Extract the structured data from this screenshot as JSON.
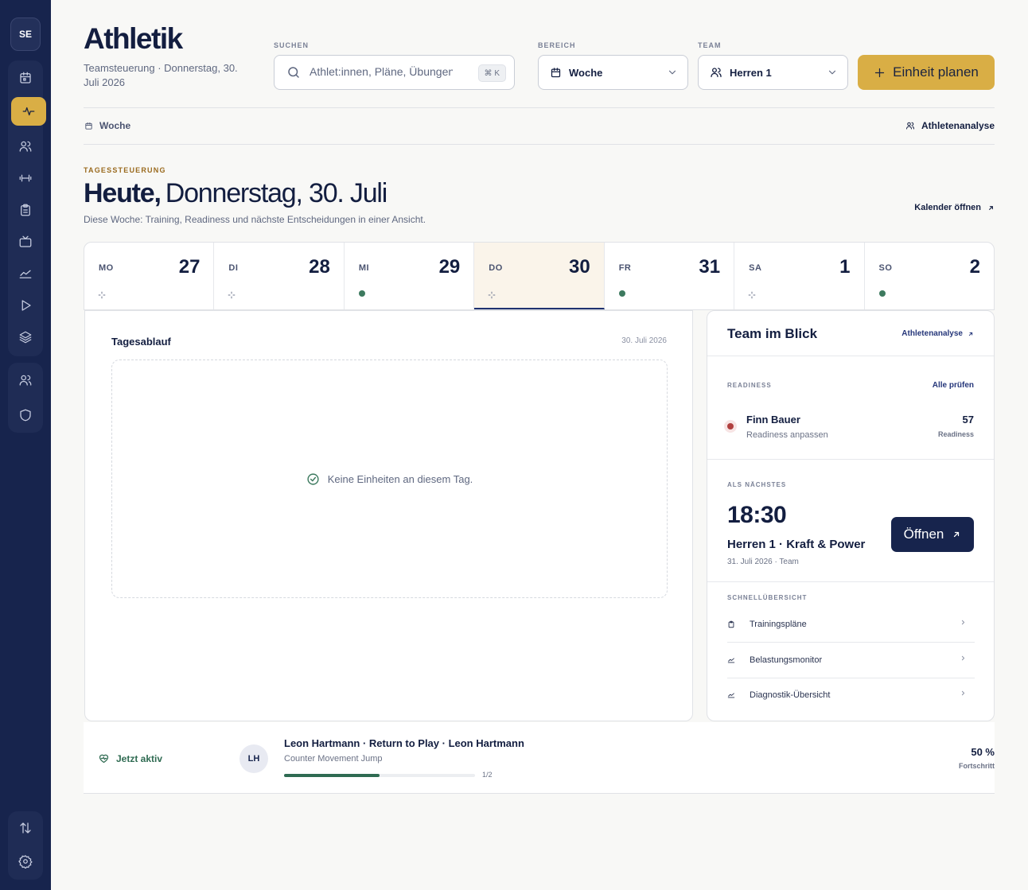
{
  "sidebar": {
    "avatar": "SE",
    "items": [
      {
        "icon": "calendar-icon"
      },
      {
        "icon": "activity-icon",
        "active": true
      },
      {
        "icon": "users-icon"
      },
      {
        "icon": "dumbbell-icon"
      },
      {
        "icon": "clipboard-icon"
      },
      {
        "icon": "tv-icon"
      },
      {
        "icon": "chart-line-icon"
      },
      {
        "icon": "play-icon"
      },
      {
        "icon": "layers-icon"
      },
      {
        "icon": "team-icon"
      },
      {
        "icon": "shield-icon"
      },
      {
        "icon": "sort-arrows-icon"
      },
      {
        "icon": "gear-icon"
      }
    ]
  },
  "header": {
    "title": "Athletik",
    "subtitle": "Teamsteuerung · Donnerstag, 30. Juli 2026",
    "search": {
      "label": "SUCHEN",
      "placeholder": "Athlet:innen, Pläne, Übungen",
      "shortcut": "⌘ K"
    },
    "range": {
      "label": "BEREICH",
      "value": "Woche"
    },
    "team": {
      "label": "TEAM",
      "value": "Herren 1"
    },
    "plan_button": "Einheit planen",
    "tab_left": "Woche",
    "tab_right": "Athletenanalyse"
  },
  "day_section": {
    "eyebrow": "TAGESSTEUERUNG",
    "heading_bold": "Heute,",
    "heading_rest": "Donnerstag, 30. Juli",
    "description": "Diese Woche: Training, Readiness und nächste Entscheidungen in einer Ansicht.",
    "calendar_link": "Kalender öffnen"
  },
  "week": [
    {
      "name": "MO",
      "num": "27",
      "marker": "pending"
    },
    {
      "name": "DI",
      "num": "28",
      "marker": "pending"
    },
    {
      "name": "MI",
      "num": "29",
      "marker": "dot"
    },
    {
      "name": "DO",
      "num": "30",
      "marker": "pending",
      "today": true
    },
    {
      "name": "FR",
      "num": "31",
      "marker": "dot"
    },
    {
      "name": "SA",
      "num": "1",
      "marker": "pending"
    },
    {
      "name": "SO",
      "num": "2",
      "marker": "dot"
    }
  ],
  "timeline": {
    "title": "Tagesablauf",
    "date": "30. Juli 2026",
    "empty_text": "Keine Einheiten an diesem Tag."
  },
  "team_card": {
    "title": "Team im Blick",
    "link": "Athletenanalyse",
    "readiness": {
      "label": "READINESS",
      "link": "Alle prüfen",
      "name": "Finn Bauer",
      "sub": "Readiness anpassen",
      "value": "57",
      "value_label": "Readiness",
      "status_color": "#b0403f"
    },
    "next": {
      "label": "ALS NÄCHSTES",
      "time": "18:30",
      "title": "Herren 1 · Kraft & Power",
      "meta": "31. Juli 2026 · Team",
      "button": "Öffnen"
    },
    "quick": {
      "label": "SCHNELLÜBERSICHT",
      "items": [
        {
          "label": "Trainingspläne",
          "icon": "clipboard-icon"
        },
        {
          "label": "Belastungsmonitor",
          "icon": "chart-line-icon"
        },
        {
          "label": "Diagnostik-Übersicht",
          "icon": "chart-line-icon"
        }
      ]
    }
  },
  "active": {
    "label": "Jetzt aktiv",
    "initials": "LH",
    "title": "Leon Hartmann · Return to Play · Leon Hartmann",
    "exercise": "Counter Movement Jump",
    "step": "1/2",
    "progress_fraction": 0.5,
    "percent": "50 %",
    "percent_label": "Fortschritt"
  },
  "colors": {
    "sidebar": "#17244d",
    "accent_gold": "#d9ae45",
    "success_green": "#3d7a5f",
    "navy": "#131e40"
  }
}
